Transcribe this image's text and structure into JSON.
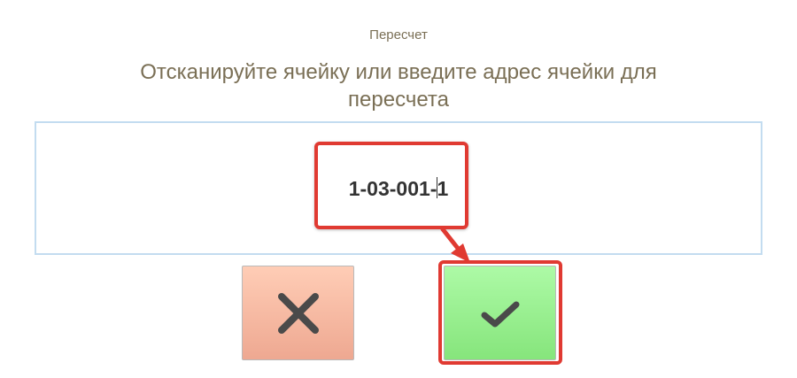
{
  "window": {
    "title": "Пересчет"
  },
  "prompt": {
    "text": "Отсканируйте ячейку или введите адрес ячейки для пересчета"
  },
  "input": {
    "value_before_caret": "1-03-001-",
    "value_after_caret": "1"
  },
  "buttons": {
    "cancel_icon": "close-icon",
    "ok_icon": "check-icon"
  },
  "colors": {
    "text": "#7a6f55",
    "input_border": "#c3dcf0",
    "cancel_bg": "#f6b9a2",
    "ok_bg": "#97ee8f",
    "highlight": "#e03a32"
  }
}
